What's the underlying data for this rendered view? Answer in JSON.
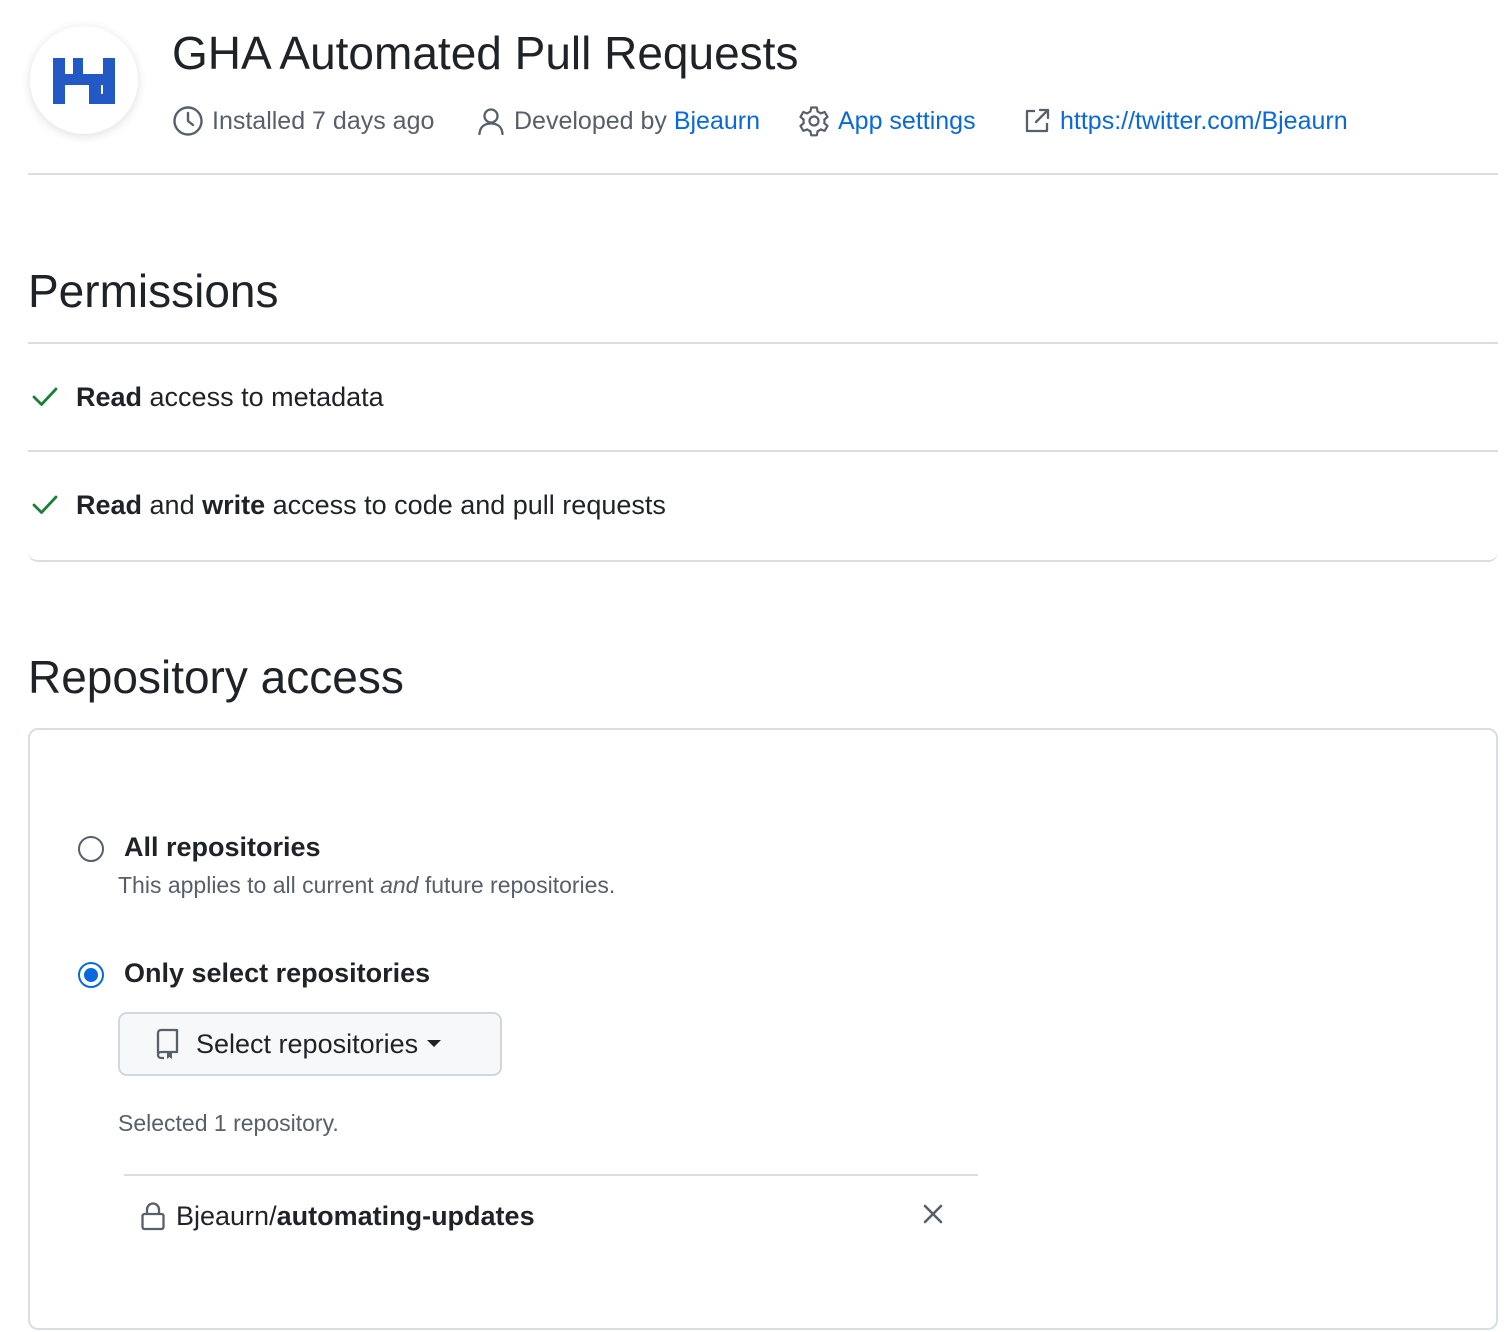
{
  "app": {
    "title": "GHA Automated Pull Requests",
    "logo_icon": "app-logo-icon",
    "installed": "Installed 7 days ago",
    "developed_prefix": "Developed by ",
    "developer": "Bjeaurn",
    "settings_label": "App settings",
    "url": "https://twitter.com/Bjeaurn"
  },
  "permissions": {
    "heading": "Permissions",
    "items": [
      {
        "parts": [
          {
            "text": "Read",
            "bold": true
          },
          {
            "text": " access to metadata",
            "bold": false
          }
        ]
      },
      {
        "parts": [
          {
            "text": "Read",
            "bold": true
          },
          {
            "text": " and ",
            "bold": false
          },
          {
            "text": "write",
            "bold": true
          },
          {
            "text": " access to code and pull requests",
            "bold": false
          }
        ]
      }
    ]
  },
  "repo_access": {
    "heading": "Repository access",
    "all": {
      "label": "All repositories",
      "desc_before": "This applies to all current ",
      "desc_em": "and",
      "desc_after": " future repositories.",
      "selected": false
    },
    "select": {
      "label": "Only select repositories",
      "selected": true,
      "button_label": "Select repositories",
      "count_text": "Selected 1 repository.",
      "repos": [
        {
          "owner": "Bjeaurn/",
          "name": "automating-updates",
          "private": true
        }
      ]
    }
  },
  "colors": {
    "link": "#0969da",
    "check": "#1a7f37",
    "brand": "#2359c4"
  }
}
